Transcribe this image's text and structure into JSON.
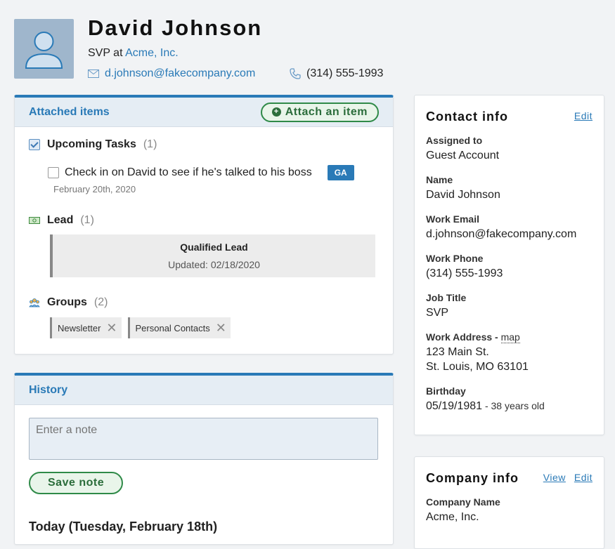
{
  "profile": {
    "name": "David Johnson",
    "role_prefix": "SVP at",
    "company": "Acme, Inc.",
    "email": "d.johnson@fakecompany.com",
    "phone": "(314) 555-1993"
  },
  "attached": {
    "title": "Attached items",
    "attach_button": "Attach an item",
    "tasks": {
      "label": "Upcoming Tasks",
      "count": "(1)",
      "item_text": "Check in on David to see if he's talked to his boss",
      "item_badge": "GA",
      "item_date": "February 20th, 2020"
    },
    "lead": {
      "label": "Lead",
      "count": "(1)",
      "box_title": "Qualified Lead",
      "box_updated": "Updated: 02/18/2020"
    },
    "groups": {
      "label": "Groups",
      "count": "(2)",
      "tags": [
        "Newsletter",
        "Personal Contacts"
      ]
    }
  },
  "history": {
    "title": "History",
    "note_placeholder": "Enter a note",
    "save_label": "Save note",
    "today_heading": "Today (Tuesday, February 18th)"
  },
  "contact_info": {
    "title": "Contact info",
    "edit": "Edit",
    "fields": {
      "assigned_label": "Assigned to",
      "assigned_value": "Guest Account",
      "name_label": "Name",
      "name_value": "David Johnson",
      "email_label": "Work Email",
      "email_value": "d.johnson@fakecompany.com",
      "phone_label": "Work Phone",
      "phone_value": "(314) 555-1993",
      "job_label": "Job Title",
      "job_value": "SVP",
      "address_label": "Work Address - ",
      "address_map": "map",
      "address_line1": "123 Main St.",
      "address_line2": "St. Louis, MO 63101",
      "birthday_label": "Birthday",
      "birthday_value": "05/19/1981",
      "birthday_age": " - 38 years old"
    }
  },
  "company_info": {
    "title": "Company info",
    "view": "View",
    "edit": "Edit",
    "name_label": "Company Name",
    "name_value": "Acme, Inc."
  },
  "colors": {
    "accent": "#2a7ab7",
    "success": "#2f8a48",
    "header_bg": "#e5edf4"
  }
}
